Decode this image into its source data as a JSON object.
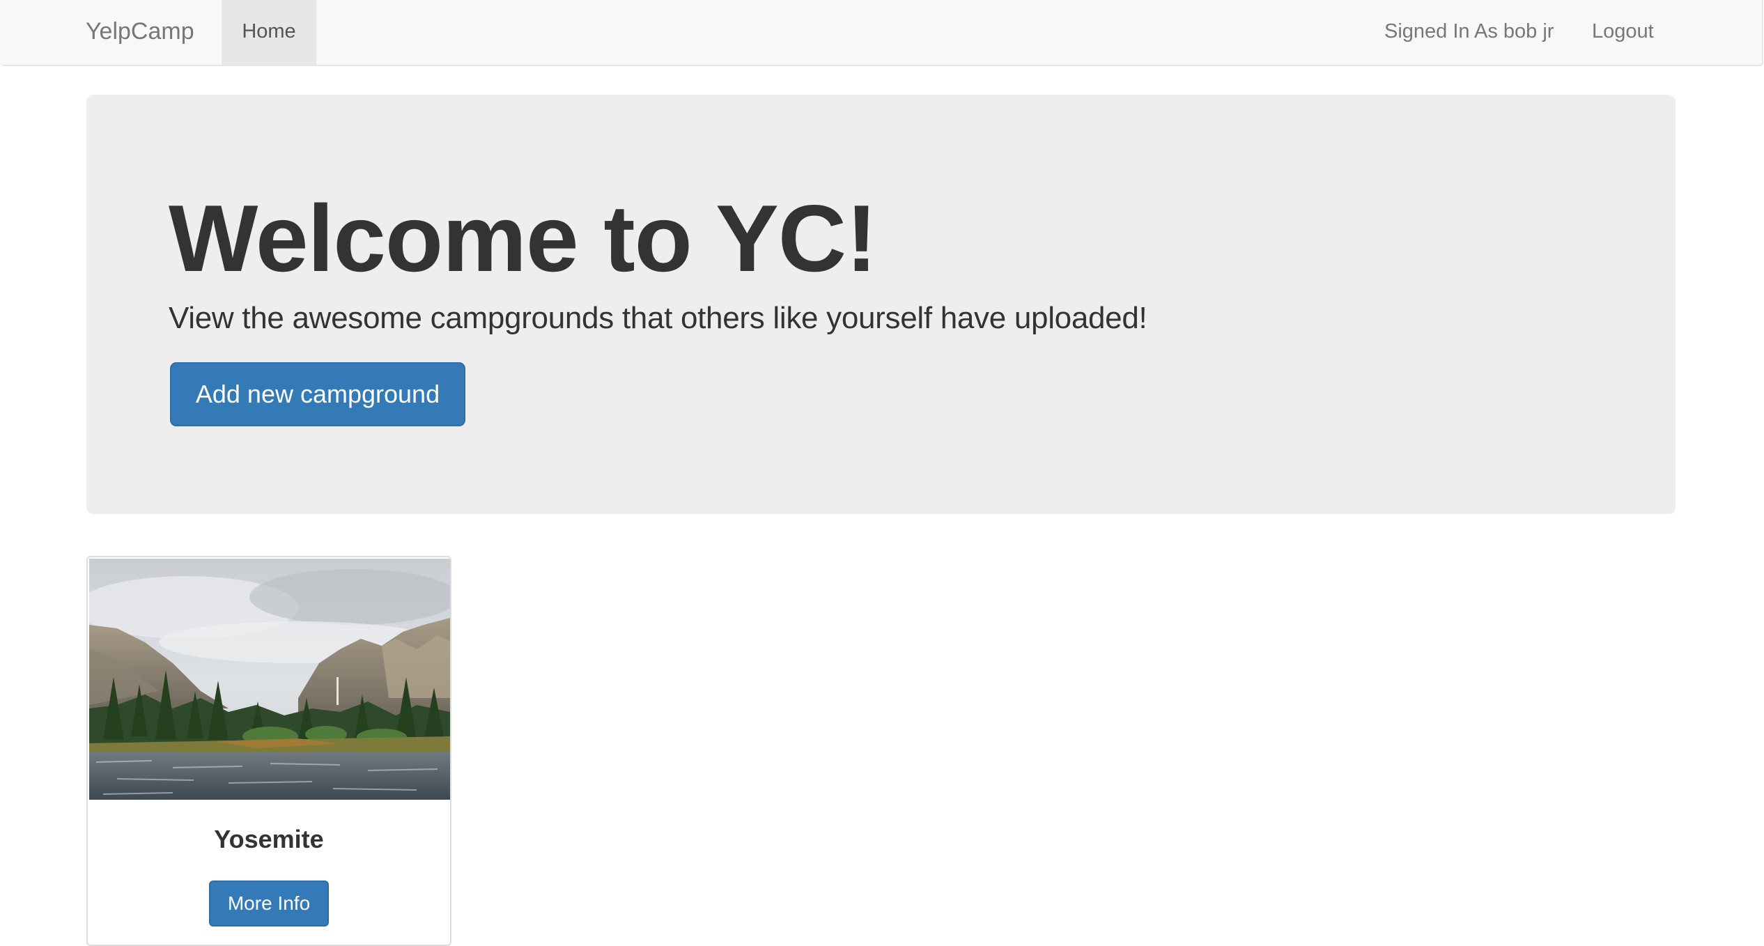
{
  "navbar": {
    "brand": "YelpCamp",
    "home_label": "Home",
    "signed_in_text": "Signed In As bob jr",
    "logout_label": "Logout"
  },
  "jumbotron": {
    "title": "Welcome to YC!",
    "subtitle": "View the awesome campgrounds that others like yourself have uploaded!",
    "add_button_label": "Add new campground"
  },
  "campgrounds": [
    {
      "name": "Yosemite",
      "image_alt": "Yosemite",
      "more_info_label": "More Info"
    }
  ],
  "colors": {
    "primary": "#337ab7",
    "navbar_bg": "#f8f8f8",
    "jumbotron_bg": "#eeeeee"
  }
}
